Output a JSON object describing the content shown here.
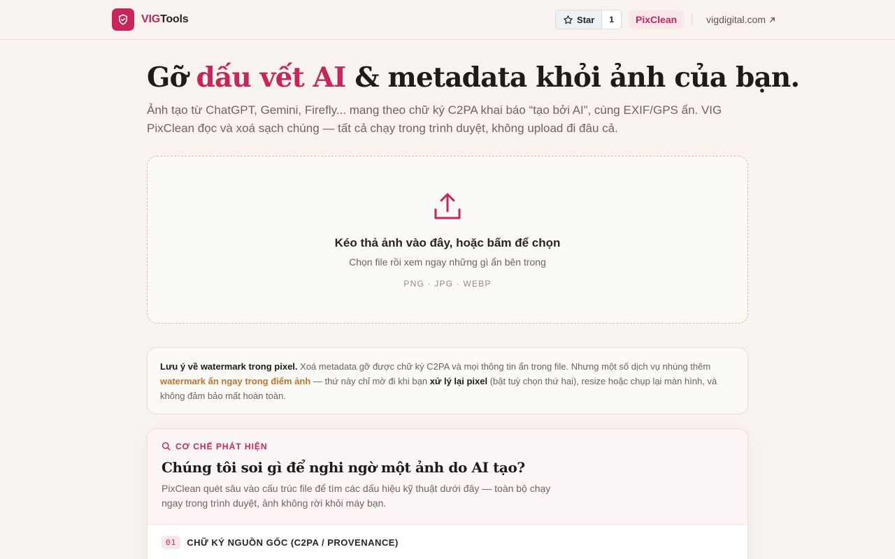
{
  "header": {
    "brand_part1": "VIG",
    "brand_part2": "Tools",
    "github_star_label": "Star",
    "github_star_count": "1",
    "nav_active": "PixClean",
    "external_link": "vigdigital.com"
  },
  "hero": {
    "title_before": "Gỡ ",
    "title_accent": "dấu vết AI",
    "title_after": " & metadata khỏi ảnh của bạn.",
    "subtitle": "Ảnh tạo từ ChatGPT, Gemini, Firefly... mang theo chữ ký C2PA khai báo “tạo bởi AI”, cùng EXIF/GPS ẩn. VIG PixClean đọc và xoá sạch chúng — tất cả chạy trong trình duyệt, không upload đi đâu cả."
  },
  "dropzone": {
    "title": "Kéo thả ảnh vào đây, hoặc bấm để chọn",
    "subtitle": "Chọn file rồi xem ngay những gì ẩn bên trong",
    "formats": "PNG · JPG · WEBP"
  },
  "notice": {
    "lead": "Lưu ý về watermark trong pixel.",
    "text1": " Xoá metadata gỡ được chữ ký C2PA và mọi thông tin ẩn trong file. Nhưng một số dịch vụ nhúng thêm ",
    "highlight": "watermark ẩn ngay trong điểm ảnh",
    "text2": " — thứ này chỉ mờ đi khi bạn ",
    "emphasis": "xử lý lại pixel",
    "text3": " (bật tuỳ chọn thứ hai), resize hoặc chụp lại màn hình, và không đảm bảo mất hoàn toàn."
  },
  "detection": {
    "eyebrow": "CƠ CHẾ PHÁT HIỆN",
    "title": "Chúng tôi soi gì để nghi ngờ một ảnh do AI tạo?",
    "description": "PixClean quét sâu vào cấu trúc file để tìm các dấu hiệu kỹ thuật dưới đây — toàn bộ chạy ngay trong trình duyệt, ảnh không rời khỏi máy bạn.",
    "items": [
      {
        "num": "01",
        "title": "CHỮ KÝ NGUỒN GỐC (C2PA / PROVENANCE)"
      }
    ]
  },
  "colors": {
    "accent": "#c8265b",
    "warm": "#c0732c",
    "background": "#f8f3ee"
  },
  "icons": [
    "shield-check-icon",
    "star-icon",
    "external-arrow-icon",
    "upload-icon",
    "search-icon"
  ]
}
